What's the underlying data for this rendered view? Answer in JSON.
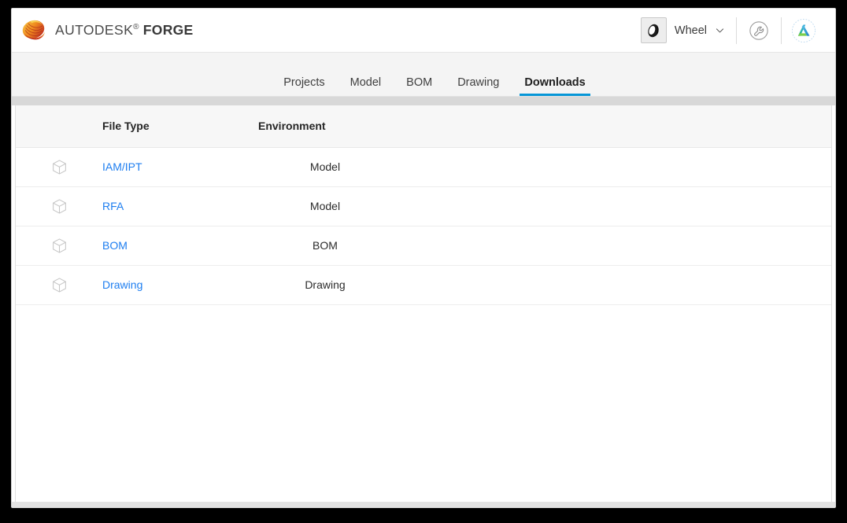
{
  "brand": {
    "name_light": "AUTODESK",
    "registered": "®",
    "name_bold": "FORGE",
    "logo_icon": "autodesk-swirl-logo"
  },
  "header": {
    "product_switcher": {
      "icon": "wheel-tire-icon",
      "label": "Wheel",
      "chevron_icon": "chevron-down-icon"
    },
    "settings": {
      "icon": "wrench-circle-icon",
      "tooltip": "Settings"
    },
    "account": {
      "icon": "autodesk-a-avatar-icon"
    }
  },
  "nav": {
    "tabs": [
      {
        "label": "Projects",
        "active": false
      },
      {
        "label": "Model",
        "active": false
      },
      {
        "label": "BOM",
        "active": false
      },
      {
        "label": "Drawing",
        "active": false
      },
      {
        "label": "Downloads",
        "active": true
      }
    ],
    "active_tab": "Downloads",
    "active_underline_color": "#0696d7"
  },
  "table": {
    "columns": [
      {
        "key": "icon",
        "label": ""
      },
      {
        "key": "file_type",
        "label": "File Type"
      },
      {
        "key": "environment",
        "label": "Environment"
      }
    ],
    "rows": [
      {
        "icon": "cube-icon",
        "file_type": "IAM/IPT",
        "environment": "Model"
      },
      {
        "icon": "cube-icon",
        "file_type": "RFA",
        "environment": "Model"
      },
      {
        "icon": "cube-icon",
        "file_type": "BOM",
        "environment": "BOM"
      },
      {
        "icon": "cube-icon",
        "file_type": "Drawing",
        "environment": "Drawing"
      }
    ]
  },
  "colors": {
    "link": "#1e7ef0",
    "accent": "#0696d7",
    "header_bg": "#ffffff",
    "nav_bg": "#f4f4f4",
    "table_header_bg": "#f7f7f7",
    "page_bg": "#000000"
  }
}
